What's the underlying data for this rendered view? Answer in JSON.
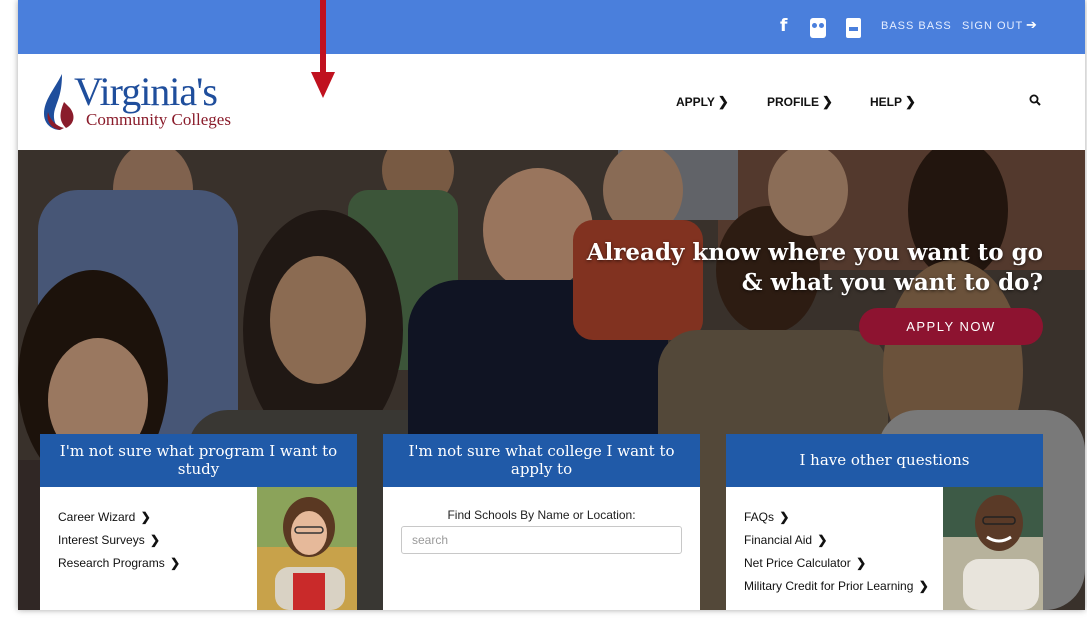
{
  "topbar": {
    "social_icons": [
      "facebook-icon",
      "flickr-icon",
      "youtube-icon"
    ],
    "facebook_glyph": "f",
    "username": "BASS BASS",
    "signout_label": "SIGN OUT",
    "signout_icon": "sign-out-icon",
    "bg_color": "#4a7fdc"
  },
  "logo": {
    "title": "Virginia's",
    "subtitle": "Community Colleges"
  },
  "nav": {
    "apply": "APPLY",
    "profile": "PROFILE",
    "help": "HELP",
    "chevron": "❯",
    "search_icon": "search-icon"
  },
  "hero": {
    "headline_line1": "Already know where you want to go",
    "headline_line2": "& what you want to do?",
    "apply_now": "APPLY NOW",
    "apply_now_color": "#8d1330"
  },
  "cards": {
    "program": {
      "title": "I'm not sure what program I want to study",
      "links": [
        "Career Wizard",
        "Interest Surveys",
        "Research Programs"
      ]
    },
    "college": {
      "title": "I'm not sure what college I want to apply to",
      "find_label": "Find Schools By Name or Location:",
      "search_placeholder": "search"
    },
    "questions": {
      "title": "I have other questions",
      "links": [
        "FAQs",
        "Financial Aid",
        "Net Price Calculator",
        "Military Credit for Prior Learning"
      ]
    },
    "header_color": "#205aa8"
  },
  "annotation": {
    "arrow_color": "#c0111f"
  }
}
